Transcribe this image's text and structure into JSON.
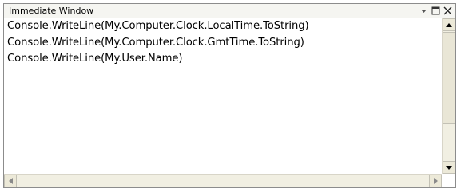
{
  "panel": {
    "title": "Immediate Window",
    "title_icons": [
      "dropdown-arrow-icon",
      "maximize-icon",
      "close-icon"
    ],
    "close_glyph": "✕"
  },
  "editor": {
    "lines": [
      "Console.WriteLine(My.Computer.Clock.LocalTime.ToString)",
      "Console.WriteLine(My.Computer.Clock.GmtTime.ToString)",
      "Console.WriteLine(My.User.Name)"
    ]
  },
  "scrollbars": {
    "vertical": {
      "up_icon": "triangle-up-icon",
      "down_icon": "triangle-down-icon"
    },
    "horizontal": {
      "left_icon": "triangle-left-icon",
      "right_icon": "triangle-right-icon"
    }
  }
}
